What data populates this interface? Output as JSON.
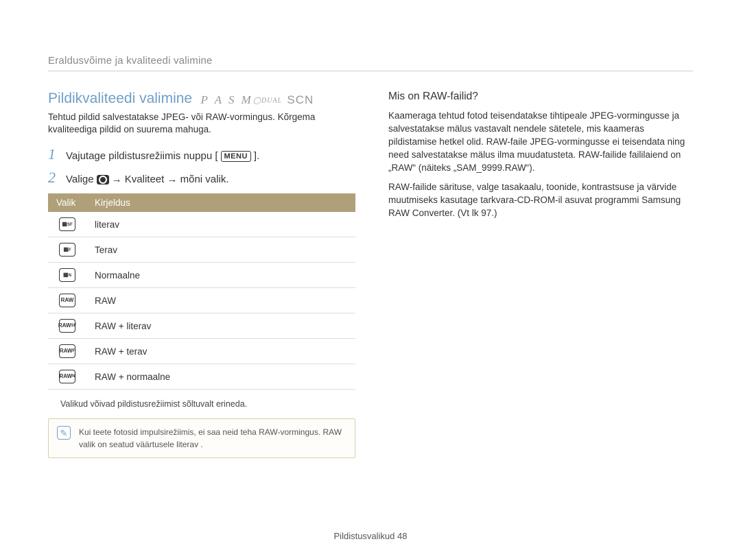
{
  "breadcrumb": "Eraldusvõime ja kvaliteedi valimine",
  "section_title": "Pildikvaliteedi valimine",
  "modes_main": "P A S M",
  "modes_suffix": "SCN",
  "intro": "Tehtud pildid salvestatakse JPEG- või RAW-vormingus. Kõrgema kvaliteediga pildid on suurema mahuga.",
  "steps": [
    {
      "num": "1",
      "pre": "Vajutage pildistusrežiimis nuppu [",
      "post": "].",
      "menu": "MENU"
    },
    {
      "num": "2",
      "body_parts": [
        "Valige ",
        " → Kvaliteet → mõni valik."
      ]
    }
  ],
  "table": {
    "headers": [
      "Valik",
      "Kirjeldus"
    ],
    "rows": [
      {
        "icon": "sf-icon",
        "label": "literav"
      },
      {
        "icon": "f-icon",
        "label": "Terav"
      },
      {
        "icon": "n-icon",
        "label": "Normaalne"
      },
      {
        "icon": "raw-icon",
        "label": "RAW"
      },
      {
        "icon": "raw-sf-icon",
        "label": "RAW +  literav"
      },
      {
        "icon": "raw-f-icon",
        "label": "RAW + terav"
      },
      {
        "icon": "raw-n-icon",
        "label": "RAW + normaalne"
      }
    ]
  },
  "table_note": "Valikud võivad pildistusrežiimist sõltuvalt erineda.",
  "note_box": "Kui teete fotosid impulsirežiimis, ei saa neid teha RAW-vormingus. RAW valik on seatud väärtusele  literav  .",
  "right_title": "Mis on RAW-failid?",
  "right_para1": "Kaameraga tehtud fotod teisendatakse tihtipeale JPEG-vormingusse ja salvestatakse mälus vastavalt nendele sätetele, mis kaameras pildistamise hetkel olid. RAW-faile JPEG-vormingusse ei teisendata ning need salvestatakse mälus ilma muudatusteta. RAW-failide faililaiend on „RAW“ (näiteks „SAM_9999.RAW“).",
  "right_para2": "RAW-failide särituse, valge tasakaalu, toonide, kontrastsuse ja värvide muutmiseks kasutage tarkvara-CD-ROM-il asuvat programmi Samsung RAW Converter. (Vt lk 97.)",
  "footer_label": "Pildistusvalikud",
  "footer_page": "48"
}
